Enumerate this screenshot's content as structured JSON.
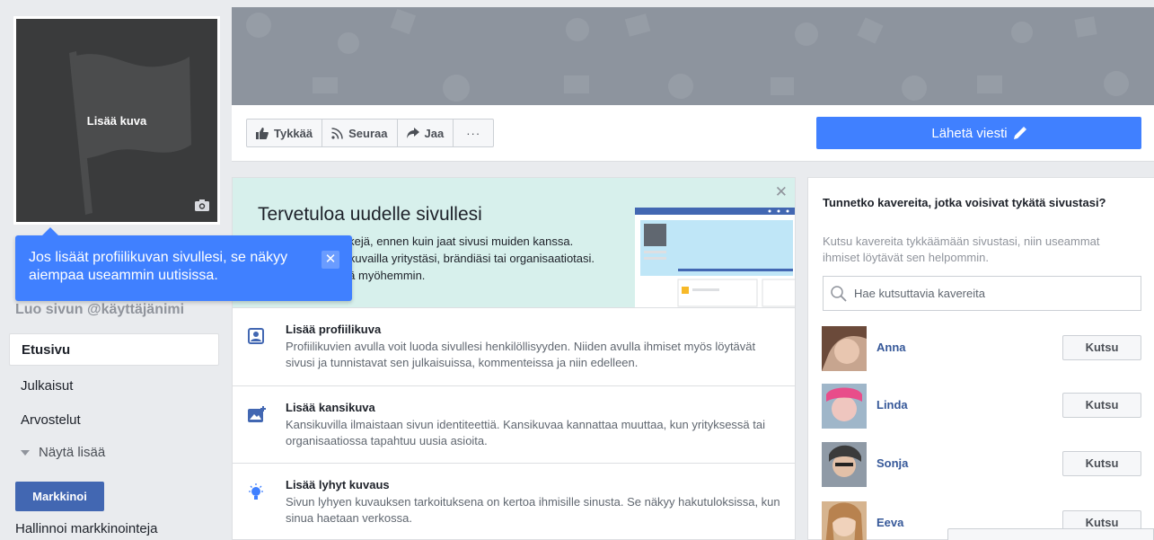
{
  "profile": {
    "add_photo_label": "Lisää kuva"
  },
  "tooltip": {
    "text": "Jos lisäät profiilikuvan sivullesi, se näkyy aiempaa useammin uutisissa.",
    "close": "✕"
  },
  "sidebar": {
    "username": "Luo sivun @käyttäjänimi",
    "items": [
      {
        "label": "Etusivu",
        "active": true
      },
      {
        "label": "Julkaisut",
        "active": false
      },
      {
        "label": "Arvostelut",
        "active": false
      }
    ],
    "show_more": "Näytä lisää",
    "market_button": "Markkinoi",
    "manage_link": "Hallinnoi markkinointeja"
  },
  "actions": {
    "like": "Tykkää",
    "follow": "Seuraa",
    "share": "Jaa",
    "more": "···",
    "send_message": "Lähetä viesti"
  },
  "welcome": {
    "title": "Tervetuloa uudelle sivullesi",
    "text": "Kokeile näitä vinkkejä, ennen kuin jaat sivusi muiden kanssa. Niiden avulla voit kuvailla yritystäsi, brändiäsi tai organisaatiotasi. Näet lisää vinkkejä myöhemmin.",
    "tips": [
      {
        "title": "Lisää profiilikuva",
        "desc": "Profiilikuvien avulla voit luoda sivullesi henkilöllisyyden. Niiden avulla ihmiset myös löytävät sivusi ja tunnistavat sen julkaisuissa, kommenteissa ja niin edelleen."
      },
      {
        "title": "Lisää kansikuva",
        "desc": "Kansikuvilla ilmaistaan sivun identiteettiä. Kansikuvaa kannattaa muuttaa, kun yrityksessä tai organisaatiossa tapahtuu uusia asioita."
      },
      {
        "title": "Lisää lyhyt kuvaus",
        "desc": "Sivun lyhyen kuvauksen tarkoituksena on kertoa ihmisille sinusta. Se näkyy hakutuloksissa, kun sinua haetaan verkossa."
      }
    ]
  },
  "invite": {
    "title": "Tunnetko kavereita, jotka voisivat tykätä sivustasi?",
    "subtitle": "Kutsu kavereita tykkäämään sivustasi, niin useammat ihmiset löytävät sen helpommin.",
    "search_placeholder": "Hae kutsuttavia kavereita",
    "button_label": "Kutsu",
    "friends": [
      {
        "name": "Anna"
      },
      {
        "name": "Linda"
      },
      {
        "name": "Sonja"
      },
      {
        "name": "Eeva"
      }
    ]
  },
  "colors": {
    "brand_blue": "#4267b2",
    "accent_blue": "#4080ff",
    "link": "#365899"
  }
}
